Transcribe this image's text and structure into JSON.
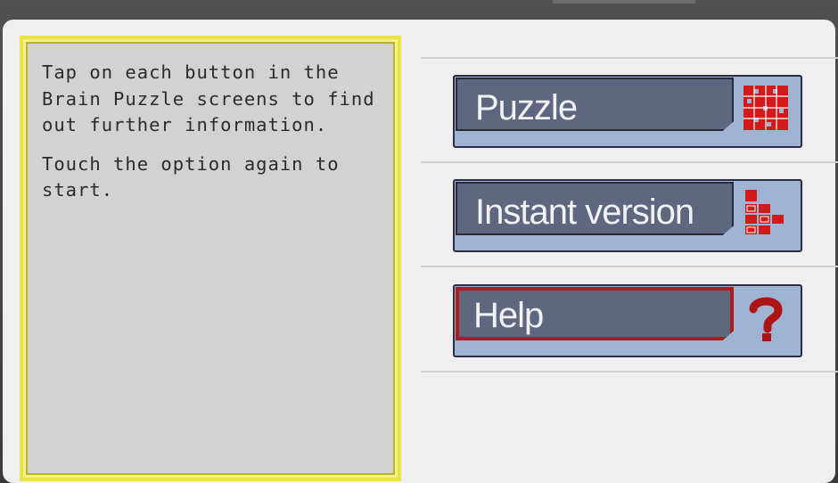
{
  "info": {
    "paragraph1": "Tap on each button in the Brain Puzzle screens to find out further information.",
    "paragraph2": "Touch the option again to start."
  },
  "menu": {
    "puzzle_label": "Puzzle",
    "puzzle_icon": "grid-icon",
    "instant_label": "Instant version",
    "instant_icon": "blocks-icon",
    "help_label": "Help",
    "help_icon": "question-icon"
  },
  "colors": {
    "accent_red": "#d11a1a",
    "frame_yellow": "#e8e34a",
    "button_blue": "#9fb3d3",
    "label_slate": "#5f6680"
  }
}
